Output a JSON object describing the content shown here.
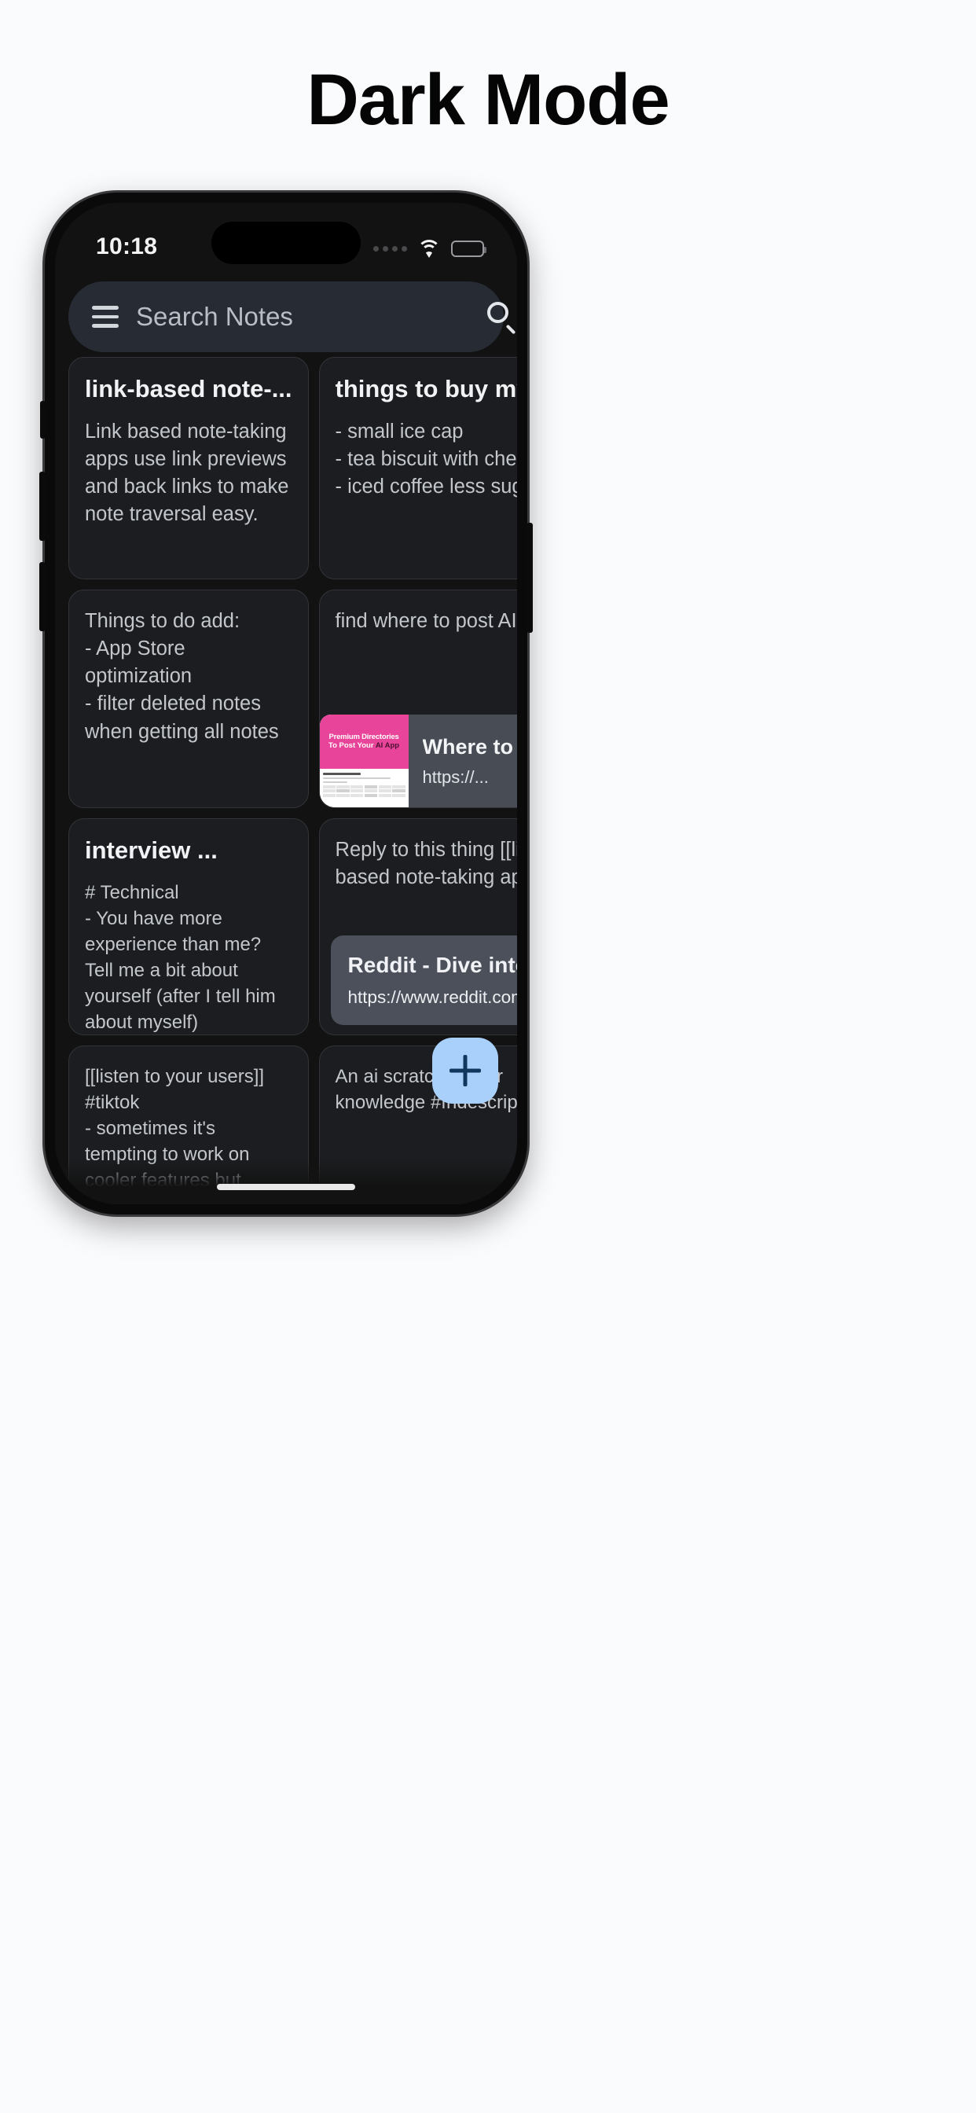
{
  "headline": "Dark Mode",
  "status": {
    "time": "10:18",
    "cellular_icon": "cellular-dots-icon",
    "wifi_icon": "wifi-icon",
    "battery_icon": "battery-full-icon"
  },
  "search": {
    "menu_icon": "hamburger-menu-icon",
    "placeholder": "Search Notes",
    "value": "",
    "search_icon": "search-icon"
  },
  "fab": {
    "icon": "plus-icon",
    "label": "+"
  },
  "colors": {
    "page_bg": "#fafbfd",
    "app_bg": "#121212",
    "card_bg": "#1b1d20",
    "card_border": "#313438",
    "searchbar_bg": "#272b33",
    "link_card_bg": "#4b505a",
    "fab_bg": "#a9d0fb",
    "fab_icon": "#12375e",
    "accent_pink": "#e8459a"
  },
  "notes": {
    "left": [
      {
        "title": "link-based note-...",
        "body": "Link based note-taking apps use link previews and back links to make note traversal easy."
      },
      {
        "title": "",
        "body": "Things to do add:\n- App Store optimization\n- filter deleted notes when getting all notes"
      },
      {
        "title": "interview ...",
        "body": "# Technical\n- You have more experience than me? Tell me a bit about yourself (after I tell him about myself)"
      },
      {
        "title": "",
        "body": "[[listen to your users]]\n#tiktok\n- sometimes it's tempting to work on cooler features but"
      }
    ],
    "right": [
      {
        "title": "things to buy my...",
        "body": "- small ice cap\n- tea biscuit with cheese\n- iced coffee less sugar"
      },
      {
        "title": "",
        "body": "find where to post AI app",
        "preview": {
          "image_line1": "Premium Directories",
          "image_line2a": "To Post Your ",
          "image_line2b": "AI App",
          "title": "Where to ...",
          "url": "https://..."
        }
      },
      {
        "title": "",
        "body": "Reply to this thing [[link-based note-taking app]]",
        "link": {
          "title": "Reddit - Dive into ...",
          "url": "https://www.reddit.com/r/..."
        }
      },
      {
        "title": "",
        "body": "An ai scratchpad for knowledge #fndescription"
      }
    ]
  }
}
